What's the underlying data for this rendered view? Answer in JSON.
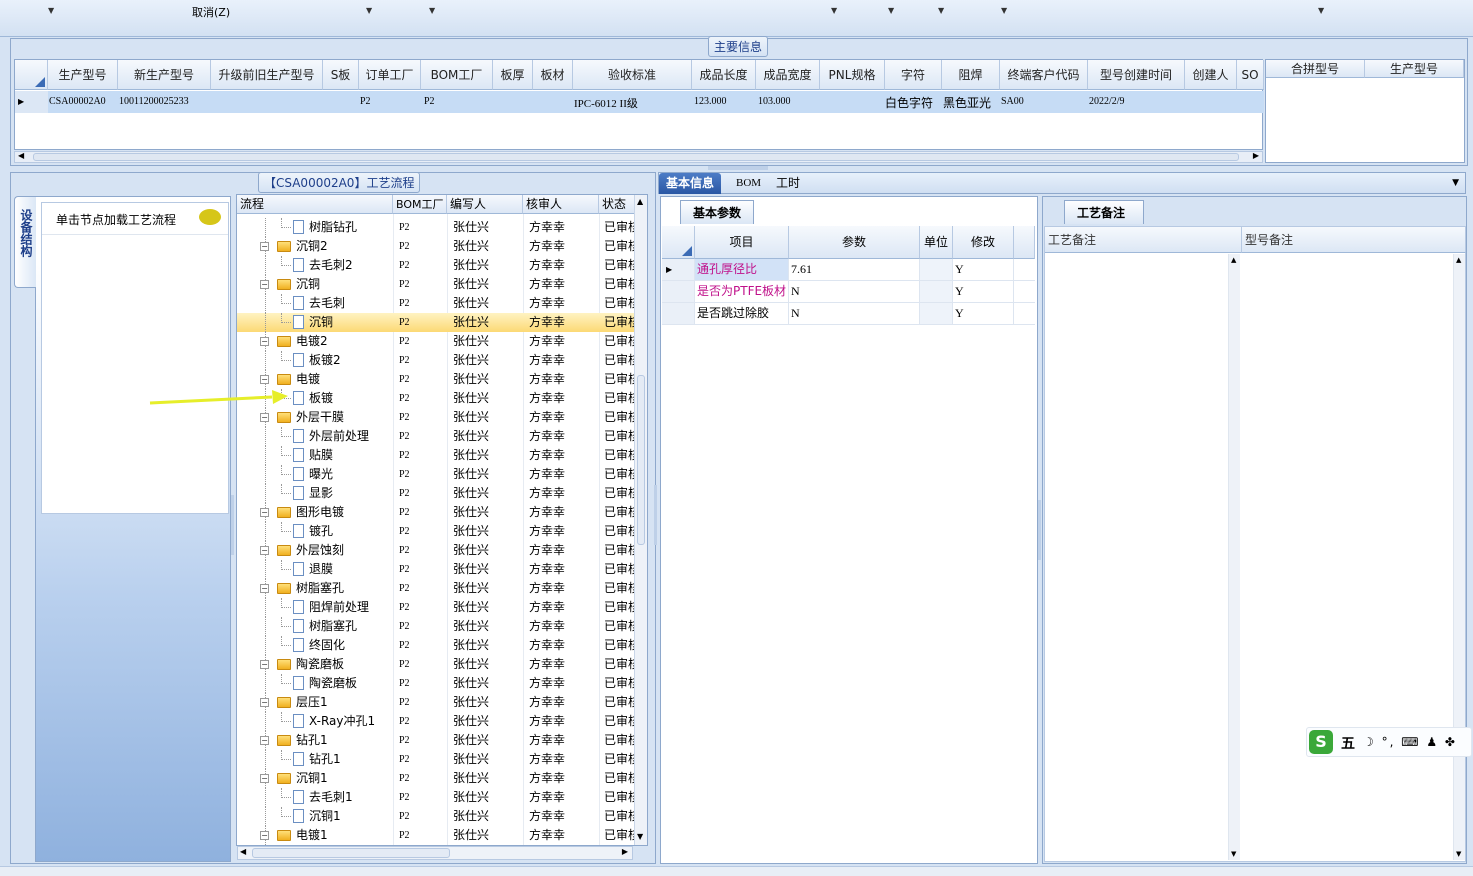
{
  "toolbar": {
    "cancel_label": "取消(Z)"
  },
  "main_panel": {
    "title": "主要信息",
    "columns": [
      "生产型号",
      "新生产型号",
      "升级前旧生产型号",
      "S板",
      "订单工厂",
      "BOM工厂",
      "板厚",
      "板材",
      "验收标准",
      "成品长度",
      "成品宽度",
      "PNL规格",
      "字符",
      "阻焊",
      "终端客户代码",
      "型号创建时间",
      "创建人",
      "SO"
    ],
    "row": {
      "prod_no": "CSA00002A0",
      "new_prod_no": "10011200025233",
      "old_prod_no": "",
      "s_board": "",
      "order_factory": "P2",
      "bom_factory": "P2",
      "thickness": "",
      "material": "",
      "standard": "IPC-6012 II级",
      "length": "123.000",
      "width": "103.000",
      "pnl": "",
      "char": "白色字符",
      "mask": "黑色亚光",
      "customer": "SA00",
      "created": "2022/2/9",
      "creator": "",
      "so": ""
    },
    "merge_columns": [
      "合拼型号",
      "生产型号"
    ]
  },
  "left_panel": {
    "title": "【CSA00002A0】工艺流程",
    "side_tab": "设备结构",
    "tip": "单击节点加载工艺流程"
  },
  "tree": {
    "columns": [
      "流程",
      "BOM工厂",
      "编写人",
      "核审人",
      "状态"
    ],
    "rows": [
      {
        "name": "树脂钻孔",
        "type": "doc",
        "factory": "P2",
        "author": "张仕兴",
        "reviewer": "方幸幸",
        "status": "已审核"
      },
      {
        "name": "沉铜2",
        "type": "folder",
        "factory": "P2",
        "author": "张仕兴",
        "reviewer": "方幸幸",
        "status": "已审核"
      },
      {
        "name": "去毛刺2",
        "type": "doc",
        "factory": "P2",
        "author": "张仕兴",
        "reviewer": "方幸幸",
        "status": "已审核"
      },
      {
        "name": "沉铜",
        "type": "folder",
        "factory": "P2",
        "author": "张仕兴",
        "reviewer": "方幸幸",
        "status": "已审核"
      },
      {
        "name": "去毛刺",
        "type": "doc",
        "factory": "P2",
        "author": "张仕兴",
        "reviewer": "方幸幸",
        "status": "已审核"
      },
      {
        "name": "沉铜",
        "type": "doc",
        "factory": "P2",
        "author": "张仕兴",
        "reviewer": "方幸幸",
        "status": "已审核",
        "selected": true
      },
      {
        "name": "电镀2",
        "type": "folder",
        "factory": "P2",
        "author": "张仕兴",
        "reviewer": "方幸幸",
        "status": "已审核"
      },
      {
        "name": "板镀2",
        "type": "doc",
        "factory": "P2",
        "author": "张仕兴",
        "reviewer": "方幸幸",
        "status": "已审核"
      },
      {
        "name": "电镀",
        "type": "folder",
        "factory": "P2",
        "author": "张仕兴",
        "reviewer": "方幸幸",
        "status": "已审核"
      },
      {
        "name": "板镀",
        "type": "doc",
        "factory": "P2",
        "author": "张仕兴",
        "reviewer": "方幸幸",
        "status": "已审核"
      },
      {
        "name": "外层干膜",
        "type": "folder",
        "factory": "P2",
        "author": "张仕兴",
        "reviewer": "方幸幸",
        "status": "已审核"
      },
      {
        "name": "外层前处理",
        "type": "doc",
        "factory": "P2",
        "author": "张仕兴",
        "reviewer": "方幸幸",
        "status": "已审核"
      },
      {
        "name": "贴膜",
        "type": "doc",
        "factory": "P2",
        "author": "张仕兴",
        "reviewer": "方幸幸",
        "status": "已审核"
      },
      {
        "name": "曝光",
        "type": "doc",
        "factory": "P2",
        "author": "张仕兴",
        "reviewer": "方幸幸",
        "status": "已审核"
      },
      {
        "name": "显影",
        "type": "doc",
        "factory": "P2",
        "author": "张仕兴",
        "reviewer": "方幸幸",
        "status": "已审核"
      },
      {
        "name": "图形电镀",
        "type": "folder",
        "factory": "P2",
        "author": "张仕兴",
        "reviewer": "方幸幸",
        "status": "已审核"
      },
      {
        "name": "镀孔",
        "type": "doc",
        "factory": "P2",
        "author": "张仕兴",
        "reviewer": "方幸幸",
        "status": "已审核"
      },
      {
        "name": "外层蚀刻",
        "type": "folder",
        "factory": "P2",
        "author": "张仕兴",
        "reviewer": "方幸幸",
        "status": "已审核"
      },
      {
        "name": "退膜",
        "type": "doc",
        "factory": "P2",
        "author": "张仕兴",
        "reviewer": "方幸幸",
        "status": "已审核"
      },
      {
        "name": "树脂塞孔",
        "type": "folder",
        "factory": "P2",
        "author": "张仕兴",
        "reviewer": "方幸幸",
        "status": "已审核"
      },
      {
        "name": "阻焊前处理",
        "type": "doc",
        "factory": "P2",
        "author": "张仕兴",
        "reviewer": "方幸幸",
        "status": "已审核"
      },
      {
        "name": "树脂塞孔",
        "type": "doc",
        "factory": "P2",
        "author": "张仕兴",
        "reviewer": "方幸幸",
        "status": "已审核"
      },
      {
        "name": "终固化",
        "type": "doc",
        "factory": "P2",
        "author": "张仕兴",
        "reviewer": "方幸幸",
        "status": "已审核"
      },
      {
        "name": "陶瓷磨板",
        "type": "folder",
        "factory": "P2",
        "author": "张仕兴",
        "reviewer": "方幸幸",
        "status": "已审核"
      },
      {
        "name": "陶瓷磨板",
        "type": "doc",
        "factory": "P2",
        "author": "张仕兴",
        "reviewer": "方幸幸",
        "status": "已审核"
      },
      {
        "name": "层压1",
        "type": "folder",
        "factory": "P2",
        "author": "张仕兴",
        "reviewer": "方幸幸",
        "status": "已审核"
      },
      {
        "name": "X-Ray冲孔1",
        "type": "doc",
        "factory": "P2",
        "author": "张仕兴",
        "reviewer": "方幸幸",
        "status": "已审核"
      },
      {
        "name": "钻孔1",
        "type": "folder",
        "factory": "P2",
        "author": "张仕兴",
        "reviewer": "方幸幸",
        "status": "已审核"
      },
      {
        "name": "钻孔1",
        "type": "doc",
        "factory": "P2",
        "author": "张仕兴",
        "reviewer": "方幸幸",
        "status": "已审核"
      },
      {
        "name": "沉铜1",
        "type": "folder",
        "factory": "P2",
        "author": "张仕兴",
        "reviewer": "方幸幸",
        "status": "已审核"
      },
      {
        "name": "去毛刺1",
        "type": "doc",
        "factory": "P2",
        "author": "张仕兴",
        "reviewer": "方幸幸",
        "status": "已审核"
      },
      {
        "name": "沉铜1",
        "type": "doc",
        "factory": "P2",
        "author": "张仕兴",
        "reviewer": "方幸幸",
        "status": "已审核"
      },
      {
        "name": "电镀1",
        "type": "folder",
        "factory": "P2",
        "author": "张仕兴",
        "reviewer": "方幸幸",
        "status": "已审核"
      }
    ]
  },
  "right_tabs": [
    "基本信息",
    "BOM",
    "工时"
  ],
  "basic": {
    "subtab": "基本参数",
    "columns": [
      "项目",
      "参数",
      "单位",
      "修改"
    ],
    "rows": [
      {
        "item": "通孔厚径比",
        "value": "7.61",
        "unit": "",
        "modify": "Y",
        "highlight": true
      },
      {
        "item": "是否为PTFE板材",
        "value": "N",
        "unit": "",
        "modify": "Y",
        "highlight": true
      },
      {
        "item": "是否跳过除胶",
        "value": "N",
        "unit": "",
        "modify": "Y",
        "highlight": false
      }
    ]
  },
  "notes": {
    "subtab": "工艺备注",
    "columns": [
      "工艺备注",
      "型号备注"
    ]
  },
  "ime": {
    "logo": "S",
    "mode": "五",
    "symbols": "☽ °, ⌨ ♟ ✤"
  },
  "colors": {
    "accent": "#2a57a4",
    "highlight_text": "#c0108a",
    "selected_row": "#fcd975",
    "arrow": "#e6ee2a"
  }
}
